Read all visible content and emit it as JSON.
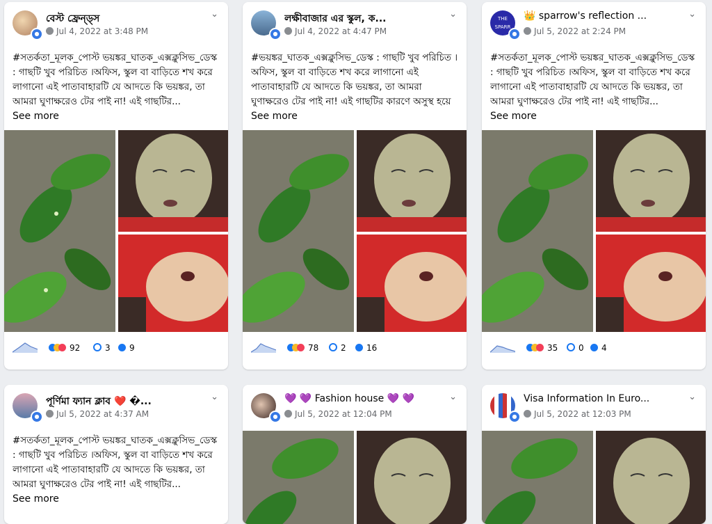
{
  "colors": {
    "like": "#1877f2",
    "haha": "#f7b928",
    "love": "#f33e58",
    "share": "#1877f2",
    "comment": "#1877f2"
  },
  "posts": [
    {
      "name": "বেস্ট ফ্রেন্ড্স",
      "date": "Jul 4, 2022 at 3:48 PM",
      "text": "#সতর্কতা_মূলক_পোস্ট ভয়ঙ্কর_ঘাতক_এক্সক্লুসিভ_ডেস্ক : গাছটি খুব পরিচিত ।অফিস, স্কুল বা বাড়িতে শখ করে লাগানো এই পাতাবাহারটি যে আদতে কি ভয়ঙ্কর, তা আমরা ঘুণাক্ষরেও টের পাই না! এই গাছটির...",
      "see_more": "See more",
      "reactions": "92",
      "comments": "3",
      "shares": "9"
    },
    {
      "name": "লক্ষীবাজার এর স্কুল, ক...",
      "date": "Jul 4, 2022 at 4:47 PM",
      "text": "#ভয়ঙ্কর_ঘাতক_এক্সক্লুসিভ_ডেস্ক : গাছটি খুব পরিচিত ।অফিস, স্কুল বা বাড়িতে শখ করে লাগানো এই পাতাবাহারটি যে আদতে কি ভয়ঙ্কর, তা আমরা ঘুণাক্ষরেও টের পাই না! এই গাছটির কারণে অসুস্থ হয়ে পড়তে পারেন আপনি, এমন...",
      "see_more": "See more",
      "reactions": "78",
      "comments": "2",
      "shares": "16"
    },
    {
      "name": "👑 sparrow's reflection ...",
      "date": "Jul 5, 2022 at 2:24 PM",
      "text": "#সতর্কতা_মূলক_পোস্ট ভয়ঙ্কর_ঘাতক_এক্সক্লুসিভ_ডেস্ক : গাছটি খুব পরিচিত ।অফিস, স্কুল বা বাড়িতে শখ করে লাগানো এই পাতাবাহারটি যে আদতে কি ভয়ঙ্কর, তা আমরা ঘুণাক্ষরেও টের পাই না! এই গাছটির...",
      "see_more": "See more",
      "reactions": "35",
      "comments": "0",
      "shares": "4",
      "avatar_text": "THE SPARR"
    },
    {
      "name": "পূর্ণিমা ফ্যান ক্লাব ❤️ �...",
      "date": "Jul 5, 2022 at 4:37 AM",
      "text": "#সতর্কতা_মূলক_পোস্ট ভয়ঙ্কর_ঘাতক_এক্সক্লুসিভ_ডেস্ক : গাছটি খুব পরিচিত ।অফিস, স্কুল বা বাড়িতে শখ করে লাগানো এই পাতাবাহারটি যে আদতে কি ভয়ঙ্কর, তা আমরা ঘুণাক্ষরেও টের পাই না! এই গাছটির...",
      "see_more": "See more"
    },
    {
      "name": "💜 💜 Fashion house 💜 💜",
      "date": "Jul 5, 2022 at 12:04 PM"
    },
    {
      "name": "Visa Information In Euro...",
      "date": "Jul 5, 2022 at 12:03 PM"
    }
  ]
}
